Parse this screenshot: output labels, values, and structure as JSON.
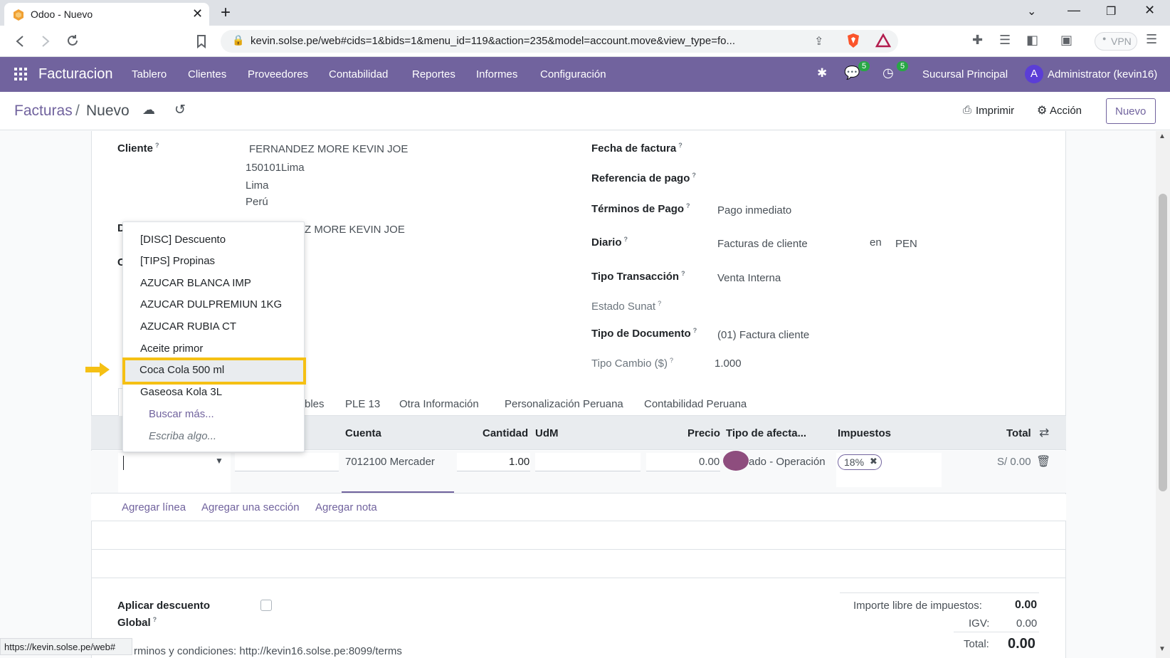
{
  "browser": {
    "tab_title": "Odoo - Nuevo",
    "url": "kevin.solse.pe/web#cids=1&bids=1&menu_id=119&action=235&model=account.move&view_type=fo...",
    "vpn_label": "VPN",
    "status_url": "https://kevin.solse.pe/web#"
  },
  "navbar": {
    "app_name": "Facturacion",
    "menu": [
      "Tablero",
      "Clientes",
      "Proveedores",
      "Contabilidad",
      "Reportes",
      "Informes",
      "Configuración"
    ],
    "messages_badge": "5",
    "activities_badge": "5",
    "branch": "Sucursal Principal",
    "avatar_letter": "A",
    "user": "Administrator (kevin16)"
  },
  "control_panel": {
    "breadcrumb_parent": "Facturas",
    "breadcrumb_sep": "/",
    "breadcrumb_current": "Nuevo",
    "print_label": "Imprimir",
    "action_label": "Acción",
    "new_label": "Nuevo"
  },
  "form": {
    "cliente_label": "Cliente",
    "cliente_name": "FERNANDEZ MORE KEVIN JOE",
    "cliente_addr1": "150101Lima",
    "cliente_addr2": "Lima",
    "cliente_addr3": "Perú",
    "delivery_letter": "D",
    "delivery_name": "Z MORE KEVIN JOE",
    "hidden_letter": "C",
    "fecha_label": "Fecha de factura",
    "ref_pago_label": "Referencia de pago",
    "terminos_label": "Términos de Pago",
    "terminos_value": "Pago inmediato",
    "diario_label": "Diario",
    "diario_value": "Facturas de cliente",
    "diario_en": "en",
    "diario_currency": "PEN",
    "tipo_trans_label": "Tipo Transacción",
    "tipo_trans_value": "Venta Interna",
    "estado_sunat_label": "Estado Sunat",
    "tipo_doc_label": "Tipo de Documento",
    "tipo_doc_value": "(01) Factura cliente",
    "tipo_cambio_label": "Tipo Cambio ($)",
    "tipo_cambio_value": "1.000"
  },
  "tabs": [
    "bles",
    "PLE 13",
    "Otra Información",
    "Personalización Peruana",
    "Contabilidad Peruana"
  ],
  "table": {
    "headers": {
      "cuenta": "Cuenta",
      "cantidad": "Cantidad",
      "udm": "UdM",
      "precio": "Precio",
      "tipo_afecta": "Tipo de afecta...",
      "impuestos": "Impuestos",
      "total": "Total"
    },
    "row": {
      "cuenta": "7012100 Mercader",
      "cantidad": "1.00",
      "precio": "0.00",
      "tipo_afecta": "ado - Operación",
      "tax_tag": "18%",
      "total": "S/ 0.00"
    },
    "add_line": "Agregar línea",
    "add_section": "Agregar una sección",
    "add_note": "Agregar nota"
  },
  "dropdown": {
    "items": [
      "[DISC] Descuento",
      "[TIPS] Propinas",
      "AZUCAR BLANCA IMP",
      "AZUCAR DULPREMIUN 1KG",
      "AZUCAR RUBIA CT",
      "Aceite primor",
      "Coca Cola 500 ml",
      "Gaseosa Kola 3L"
    ],
    "selected": "Coca Cola 500 ml",
    "search_more": "Buscar más...",
    "type_something": "Escriba algo..."
  },
  "footer": {
    "discount_label_1": "Aplicar descuento",
    "discount_label_2": "Global",
    "terms": "rminos y condiciones: http://kevin16.solse.pe:8099/terms",
    "untaxed_label": "Importe libre de impuestos:",
    "untaxed_value": "0.00",
    "igv_label": "IGV:",
    "igv_value": "0.00",
    "total_label": "Total:",
    "total_value": "0.00"
  },
  "colors": {
    "brand": "#71639e",
    "highlight": "#f5c014",
    "arrow": "#f5c014"
  }
}
